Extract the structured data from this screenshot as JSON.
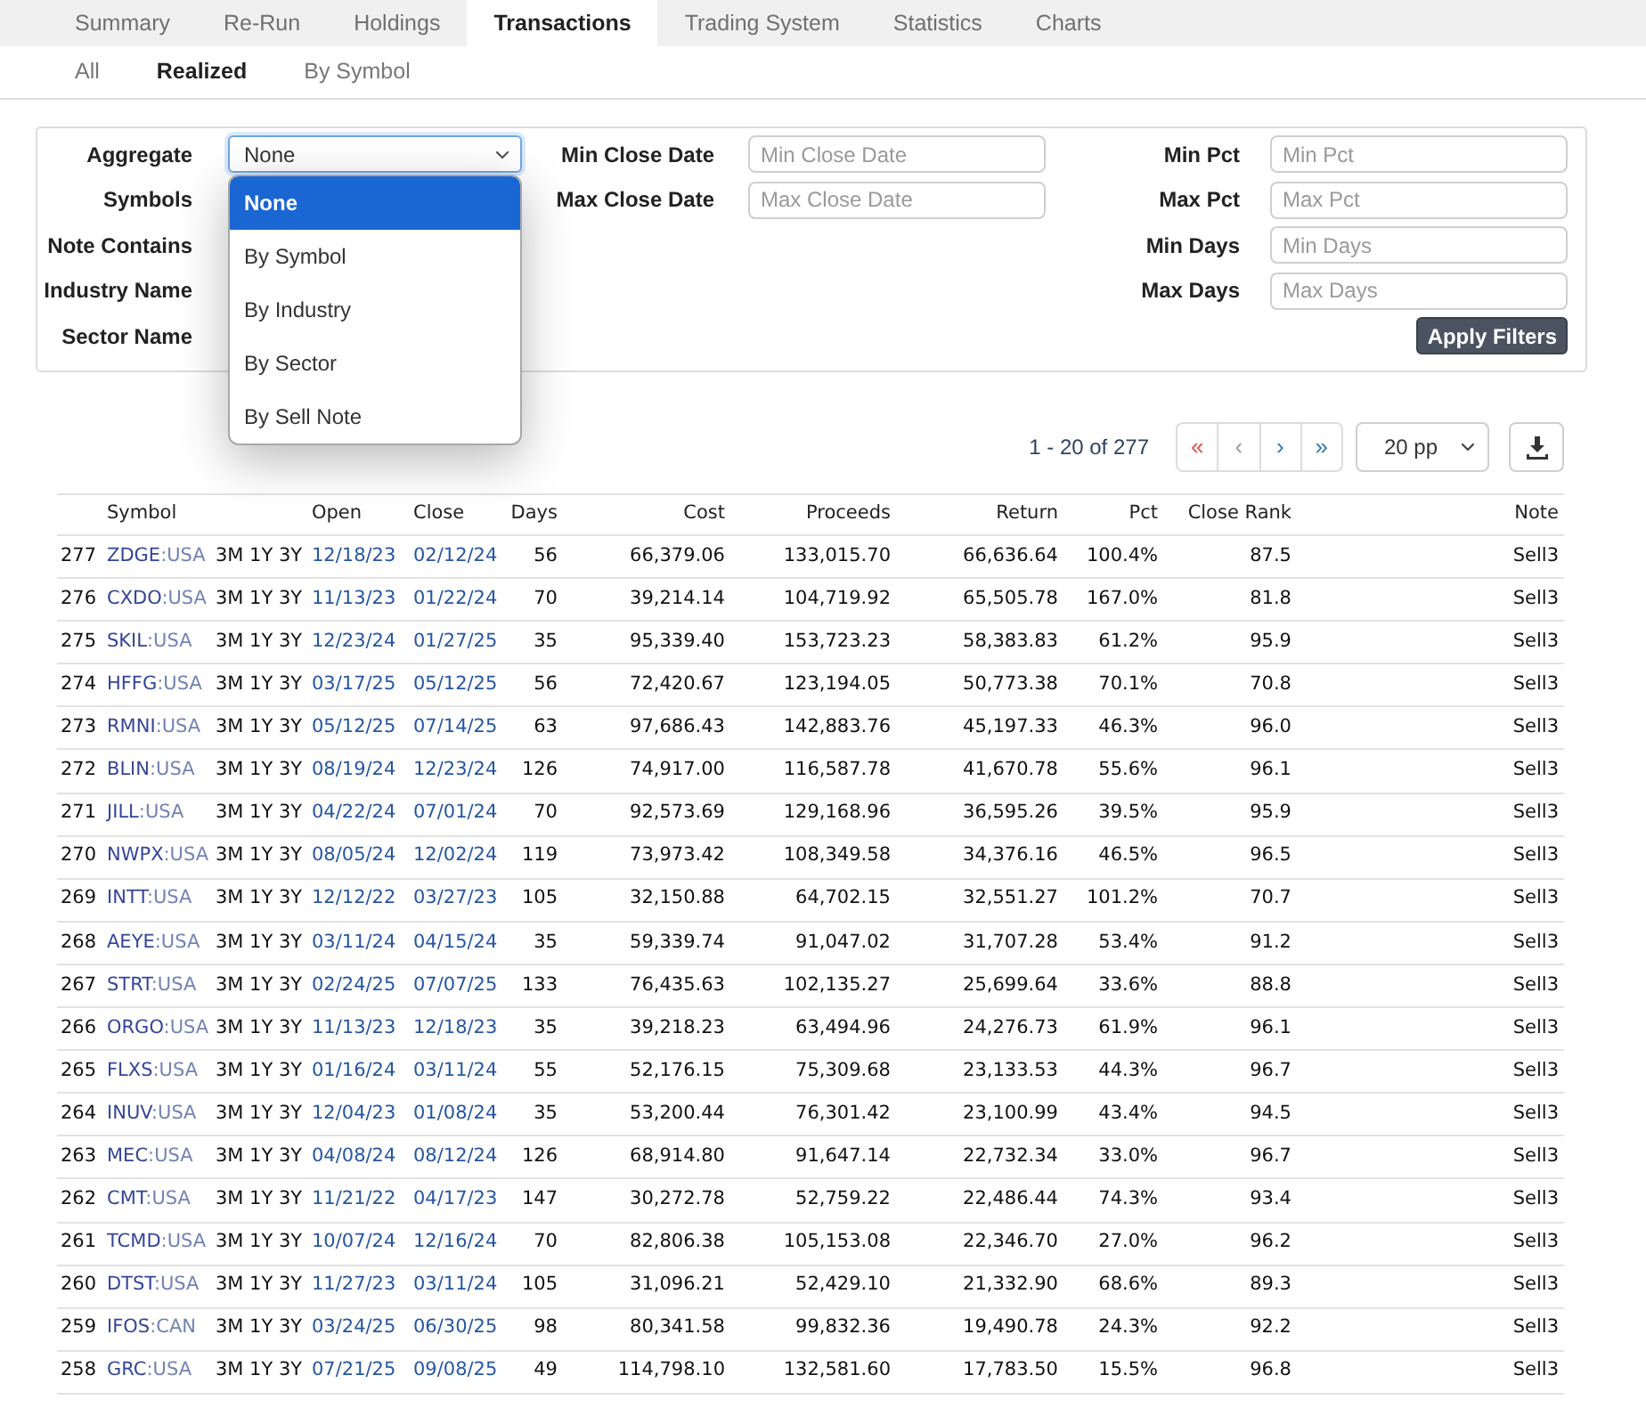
{
  "tabs": [
    {
      "label": "Summary",
      "selected": false
    },
    {
      "label": "Re-Run",
      "selected": false
    },
    {
      "label": "Holdings",
      "selected": false
    },
    {
      "label": "Transactions",
      "selected": true
    },
    {
      "label": "Trading System",
      "selected": false
    },
    {
      "label": "Statistics",
      "selected": false
    },
    {
      "label": "Charts",
      "selected": false
    }
  ],
  "subtabs": [
    {
      "label": "All",
      "selected": false
    },
    {
      "label": "Realized",
      "selected": true
    },
    {
      "label": "By Symbol",
      "selected": false
    }
  ],
  "filters": {
    "aggregate": {
      "label": "Aggregate",
      "value": "None",
      "expanded": true,
      "options": [
        {
          "label": "None",
          "selected": true
        },
        {
          "label": "By Symbol",
          "selected": false
        },
        {
          "label": "By Industry",
          "selected": false
        },
        {
          "label": "By Sector",
          "selected": false
        },
        {
          "label": "By Sell Note",
          "selected": false
        }
      ]
    },
    "left_labels": [
      "Symbols",
      "Note Contains",
      "Industry Name",
      "Sector Name"
    ],
    "date_fields": [
      {
        "label": "Min Close Date",
        "placeholder": "Min Close Date"
      },
      {
        "label": "Max Close Date",
        "placeholder": "Max Close Date"
      }
    ],
    "range_fields": [
      {
        "label": "Min Pct",
        "placeholder": "Min Pct"
      },
      {
        "label": "Max Pct",
        "placeholder": "Max Pct"
      },
      {
        "label": "Min Days",
        "placeholder": "Min Days"
      },
      {
        "label": "Max Days",
        "placeholder": "Max Days"
      }
    ],
    "apply_button": "Apply Filters"
  },
  "pagination": {
    "range": "1 - 20 of 277",
    "buttons": [
      {
        "label": "«",
        "color": "#d9534f"
      },
      {
        "label": "‹",
        "color": "#9a9a9a"
      },
      {
        "label": "›",
        "color": "#337ab7"
      },
      {
        "label": "»",
        "color": "#337ab7"
      }
    ],
    "page_size": "20 pp"
  },
  "table": {
    "columns": [
      "Symbol",
      "Open",
      "Close",
      "Days",
      "Cost",
      "Proceeds",
      "Return",
      "Pct",
      "Close Rank",
      "Note"
    ],
    "rows": [
      {
        "index": "277",
        "symbol": "ZDGE",
        "market": ":USA",
        "links": [
          "3M",
          "1Y",
          "3Y"
        ],
        "open": "12/18/23",
        "close": "02/12/24",
        "days": "56",
        "cost": "66,379.06",
        "proceeds": "133,015.70",
        "return": "66,636.64",
        "pct": "100.4%",
        "rank": "87.5",
        "note": "Sell3"
      },
      {
        "index": "276",
        "symbol": "CXDO",
        "market": ":USA",
        "links": [
          "3M",
          "1Y",
          "3Y"
        ],
        "open": "11/13/23",
        "close": "01/22/24",
        "days": "70",
        "cost": "39,214.14",
        "proceeds": "104,719.92",
        "return": "65,505.78",
        "pct": "167.0%",
        "rank": "81.8",
        "note": "Sell3"
      },
      {
        "index": "275",
        "symbol": "SKIL",
        "market": ":USA",
        "links": [
          "3M",
          "1Y",
          "3Y"
        ],
        "open": "12/23/24",
        "close": "01/27/25",
        "days": "35",
        "cost": "95,339.40",
        "proceeds": "153,723.23",
        "return": "58,383.83",
        "pct": "61.2%",
        "rank": "95.9",
        "note": "Sell3"
      },
      {
        "index": "274",
        "symbol": "HFFG",
        "market": ":USA",
        "links": [
          "3M",
          "1Y",
          "3Y"
        ],
        "open": "03/17/25",
        "close": "05/12/25",
        "days": "56",
        "cost": "72,420.67",
        "proceeds": "123,194.05",
        "return": "50,773.38",
        "pct": "70.1%",
        "rank": "70.8",
        "note": "Sell3"
      },
      {
        "index": "273",
        "symbol": "RMNI",
        "market": ":USA",
        "links": [
          "3M",
          "1Y",
          "3Y"
        ],
        "open": "05/12/25",
        "close": "07/14/25",
        "days": "63",
        "cost": "97,686.43",
        "proceeds": "142,883.76",
        "return": "45,197.33",
        "pct": "46.3%",
        "rank": "96.0",
        "note": "Sell3"
      },
      {
        "index": "272",
        "symbol": "BLIN",
        "market": ":USA",
        "links": [
          "3M",
          "1Y",
          "3Y"
        ],
        "open": "08/19/24",
        "close": "12/23/24",
        "days": "126",
        "cost": "74,917.00",
        "proceeds": "116,587.78",
        "return": "41,670.78",
        "pct": "55.6%",
        "rank": "96.1",
        "note": "Sell3"
      },
      {
        "index": "271",
        "symbol": "JILL",
        "market": ":USA",
        "links": [
          "3M",
          "1Y",
          "3Y"
        ],
        "open": "04/22/24",
        "close": "07/01/24",
        "days": "70",
        "cost": "92,573.69",
        "proceeds": "129,168.96",
        "return": "36,595.26",
        "pct": "39.5%",
        "rank": "95.9",
        "note": "Sell3"
      },
      {
        "index": "270",
        "symbol": "NWPX",
        "market": ":USA",
        "links": [
          "3M",
          "1Y",
          "3Y"
        ],
        "open": "08/05/24",
        "close": "12/02/24",
        "days": "119",
        "cost": "73,973.42",
        "proceeds": "108,349.58",
        "return": "34,376.16",
        "pct": "46.5%",
        "rank": "96.5",
        "note": "Sell3"
      },
      {
        "index": "269",
        "symbol": "INTT",
        "market": ":USA",
        "links": [
          "3M",
          "1Y",
          "3Y"
        ],
        "open": "12/12/22",
        "close": "03/27/23",
        "days": "105",
        "cost": "32,150.88",
        "proceeds": "64,702.15",
        "return": "32,551.27",
        "pct": "101.2%",
        "rank": "70.7",
        "note": "Sell3"
      },
      {
        "index": "268",
        "symbol": "AEYE",
        "market": ":USA",
        "links": [
          "3M",
          "1Y",
          "3Y"
        ],
        "open": "03/11/24",
        "close": "04/15/24",
        "days": "35",
        "cost": "59,339.74",
        "proceeds": "91,047.02",
        "return": "31,707.28",
        "pct": "53.4%",
        "rank": "91.2",
        "note": "Sell3"
      },
      {
        "index": "267",
        "symbol": "STRT",
        "market": ":USA",
        "links": [
          "3M",
          "1Y",
          "3Y"
        ],
        "open": "02/24/25",
        "close": "07/07/25",
        "days": "133",
        "cost": "76,435.63",
        "proceeds": "102,135.27",
        "return": "25,699.64",
        "pct": "33.6%",
        "rank": "88.8",
        "note": "Sell3"
      },
      {
        "index": "266",
        "symbol": "ORGO",
        "market": ":USA",
        "links": [
          "3M",
          "1Y",
          "3Y"
        ],
        "open": "11/13/23",
        "close": "12/18/23",
        "days": "35",
        "cost": "39,218.23",
        "proceeds": "63,494.96",
        "return": "24,276.73",
        "pct": "61.9%",
        "rank": "96.1",
        "note": "Sell3"
      },
      {
        "index": "265",
        "symbol": "FLXS",
        "market": ":USA",
        "links": [
          "3M",
          "1Y",
          "3Y"
        ],
        "open": "01/16/24",
        "close": "03/11/24",
        "days": "55",
        "cost": "52,176.15",
        "proceeds": "75,309.68",
        "return": "23,133.53",
        "pct": "44.3%",
        "rank": "96.7",
        "note": "Sell3"
      },
      {
        "index": "264",
        "symbol": "INUV",
        "market": ":USA",
        "links": [
          "3M",
          "1Y",
          "3Y"
        ],
        "open": "12/04/23",
        "close": "01/08/24",
        "days": "35",
        "cost": "53,200.44",
        "proceeds": "76,301.42",
        "return": "23,100.99",
        "pct": "43.4%",
        "rank": "94.5",
        "note": "Sell3"
      },
      {
        "index": "263",
        "symbol": "MEC",
        "market": ":USA",
        "links": [
          "3M",
          "1Y",
          "3Y"
        ],
        "open": "04/08/24",
        "close": "08/12/24",
        "days": "126",
        "cost": "68,914.80",
        "proceeds": "91,647.14",
        "return": "22,732.34",
        "pct": "33.0%",
        "rank": "96.7",
        "note": "Sell3"
      },
      {
        "index": "262",
        "symbol": "CMT",
        "market": ":USA",
        "links": [
          "3M",
          "1Y",
          "3Y"
        ],
        "open": "11/21/22",
        "close": "04/17/23",
        "days": "147",
        "cost": "30,272.78",
        "proceeds": "52,759.22",
        "return": "22,486.44",
        "pct": "74.3%",
        "rank": "93.4",
        "note": "Sell3"
      },
      {
        "index": "261",
        "symbol": "TCMD",
        "market": ":USA",
        "links": [
          "3M",
          "1Y",
          "3Y"
        ],
        "open": "10/07/24",
        "close": "12/16/24",
        "days": "70",
        "cost": "82,806.38",
        "proceeds": "105,153.08",
        "return": "22,346.70",
        "pct": "27.0%",
        "rank": "96.2",
        "note": "Sell3"
      },
      {
        "index": "260",
        "symbol": "DTST",
        "market": ":USA",
        "links": [
          "3M",
          "1Y",
          "3Y"
        ],
        "open": "11/27/23",
        "close": "03/11/24",
        "days": "105",
        "cost": "31,096.21",
        "proceeds": "52,429.10",
        "return": "21,332.90",
        "pct": "68.6%",
        "rank": "89.3",
        "note": "Sell3"
      },
      {
        "index": "259",
        "symbol": "IFOS",
        "market": ":CAN",
        "links": [
          "3M",
          "1Y",
          "3Y"
        ],
        "open": "03/24/25",
        "close": "06/30/25",
        "days": "98",
        "cost": "80,341.58",
        "proceeds": "99,832.36",
        "return": "19,490.78",
        "pct": "24.3%",
        "rank": "92.2",
        "note": "Sell3"
      },
      {
        "index": "258",
        "symbol": "GRC",
        "market": ":USA",
        "links": [
          "3M",
          "1Y",
          "3Y"
        ],
        "open": "07/21/25",
        "close": "09/08/25",
        "days": "49",
        "cost": "114,798.10",
        "proceeds": "132,581.60",
        "return": "17,783.50",
        "pct": "15.5%",
        "rank": "96.8",
        "note": "Sell3"
      }
    ]
  }
}
